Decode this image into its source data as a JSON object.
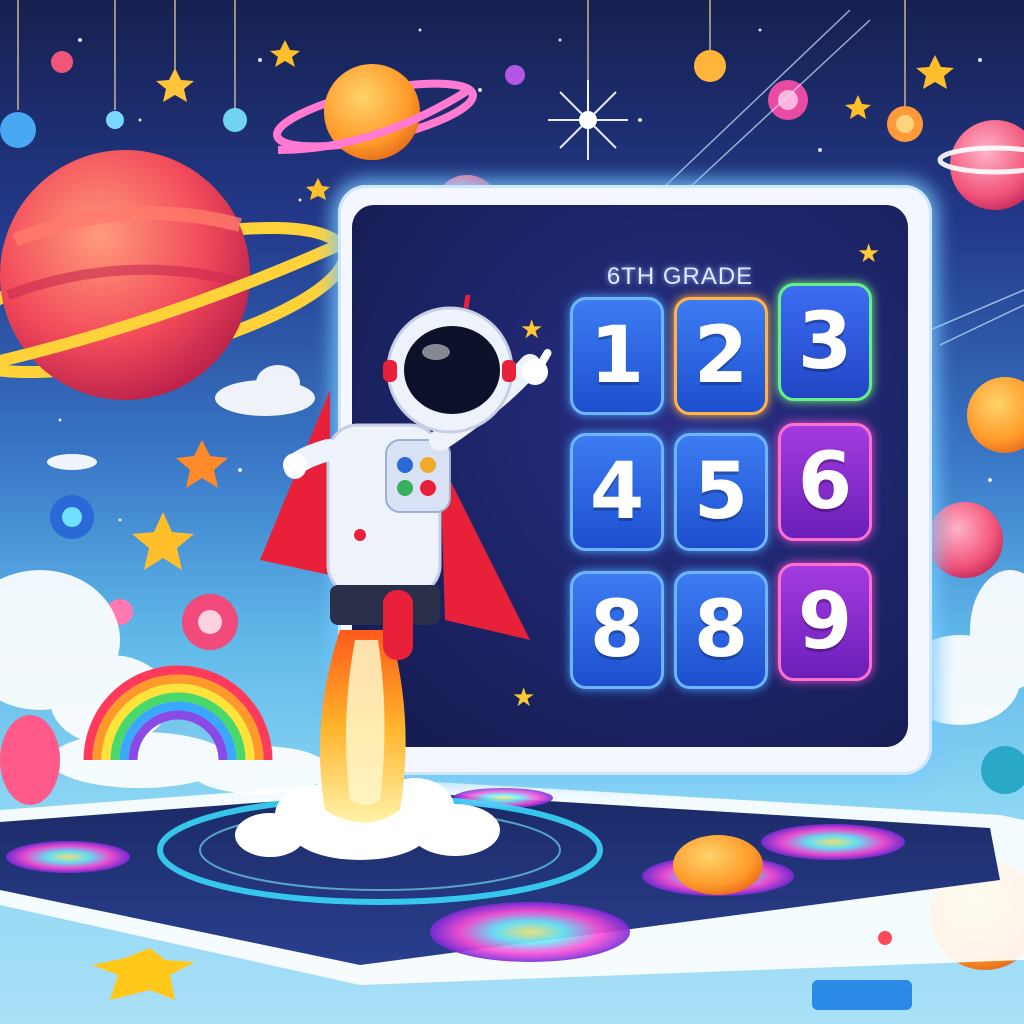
{
  "board": {
    "title": "6TH GRADE",
    "tiles": [
      "1",
      "2",
      "3",
      "4",
      "5",
      "6",
      "8",
      "8",
      "9"
    ]
  },
  "colors": {
    "tile_blue": "#2f66e6",
    "tile_purple": "#8a2fd0",
    "board_frame": "#f4f7ff",
    "screen": "#1c2466",
    "rocket_red": "#e8203a"
  },
  "icons": [
    "planet-icon",
    "star-icon",
    "rocket-icon",
    "astronaut-icon",
    "rainbow-icon",
    "cloud-icon"
  ]
}
